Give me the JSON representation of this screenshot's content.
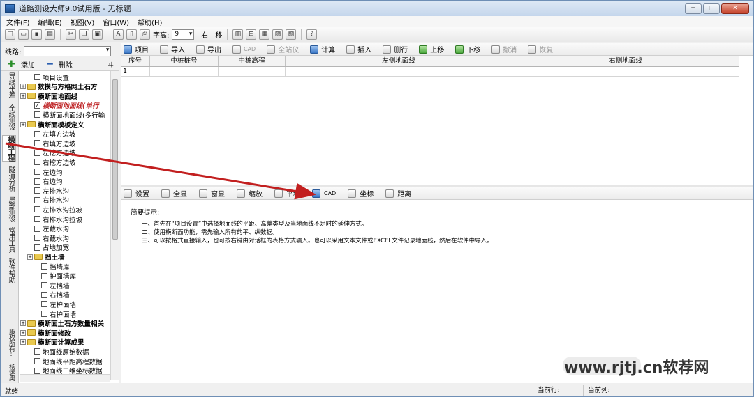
{
  "window": {
    "title": "道路测设大师9.0试用版 - 无标题",
    "min": "─",
    "max": "□",
    "close": "✕"
  },
  "menu": [
    "文件(F)",
    "编辑(E)",
    "视图(V)",
    "窗口(W)",
    "帮助(H)"
  ],
  "toolbar1": {
    "font_label": "字高:",
    "font_size": "9",
    "right_label": "右",
    "move_label": "移"
  },
  "left": {
    "line_label": "线路:",
    "add_label": "添加",
    "delete_label": "删除",
    "pin": "ヰ",
    "vtabs": [
      "导线平差",
      "全线测设",
      "横断工程",
      "隧道分析",
      "局部测设",
      "常用工具",
      "软件帮助",
      "版权所有: 杨运奥"
    ],
    "tree": [
      {
        "label": "项目设置",
        "type": "check"
      },
      {
        "label": "数模与方格网土石方",
        "type": "folder"
      },
      {
        "label": "横断面地面线",
        "type": "folder"
      },
      {
        "label": "横断面地面线(单行",
        "type": "checked"
      },
      {
        "label": "横断面地面线(多行输",
        "type": "check"
      },
      {
        "label": "横断面模板定义",
        "type": "folder"
      },
      {
        "label": "左填方边坡",
        "type": "check"
      },
      {
        "label": "右填方边坡",
        "type": "check"
      },
      {
        "label": "左挖方边坡",
        "type": "check"
      },
      {
        "label": "右挖方边坡",
        "type": "check"
      },
      {
        "label": "左边沟",
        "type": "check"
      },
      {
        "label": "右边沟",
        "type": "check"
      },
      {
        "label": "左排水沟",
        "type": "check"
      },
      {
        "label": "右排水沟",
        "type": "check"
      },
      {
        "label": "左排水沟拉坡",
        "type": "check"
      },
      {
        "label": "右排水沟拉坡",
        "type": "check"
      },
      {
        "label": "左截水沟",
        "type": "check"
      },
      {
        "label": "右截水沟",
        "type": "check"
      },
      {
        "label": "占地加宽",
        "type": "check"
      },
      {
        "label": "挡土墙",
        "type": "folder"
      },
      {
        "label": "挡墙库",
        "type": "check"
      },
      {
        "label": "护面墙库",
        "type": "check"
      },
      {
        "label": "左挡墙",
        "type": "check"
      },
      {
        "label": "右挡墙",
        "type": "check"
      },
      {
        "label": "左护面墙",
        "type": "check"
      },
      {
        "label": "右护面墙",
        "type": "check"
      },
      {
        "label": "横断面土石方数量相关",
        "type": "folder"
      },
      {
        "label": "横断面修改",
        "type": "folder"
      },
      {
        "label": "横断面计算成果",
        "type": "folder"
      },
      {
        "label": "地面线原始数据",
        "type": "check"
      },
      {
        "label": "地面线平距高程数据",
        "type": "check"
      },
      {
        "label": "地面线三维坐标数据",
        "type": "check"
      }
    ]
  },
  "toolbar2": [
    "项目",
    "导入",
    "导出",
    "CAD",
    "全站仪",
    "计算",
    "插入",
    "删行",
    "上移",
    "下移",
    "撤消",
    "恢复"
  ],
  "grid": {
    "headers": [
      "序号",
      "中桩桩号",
      "中桩高程",
      "左侧地面线",
      "右侧地面线"
    ],
    "rows": [
      [
        "1",
        "",
        "",
        "",
        ""
      ]
    ]
  },
  "toolbar3": [
    "设置",
    "全显",
    "窗显",
    "缩放",
    "平移",
    "CAD",
    "坐标",
    "距离"
  ],
  "tips": {
    "title": "简要提示:",
    "lines": [
      "一、首先在“项目设置”中选择地面线的平距、高差类型及当地面线不足时的延伸方式。",
      "二、使用横断面功能，需先输入所有的平、纵数据。",
      "三、可以按格式直接输入，也可按右键由对话框的表格方式输入。也可以采用文本文件或EXCEL文件记录地面线，然后在软件中导入。"
    ]
  },
  "status": {
    "ready": "就绪",
    "current_row": "当前行:",
    "current_col": "当前列:"
  },
  "watermark": "www.rjtj.cn软荐网"
}
